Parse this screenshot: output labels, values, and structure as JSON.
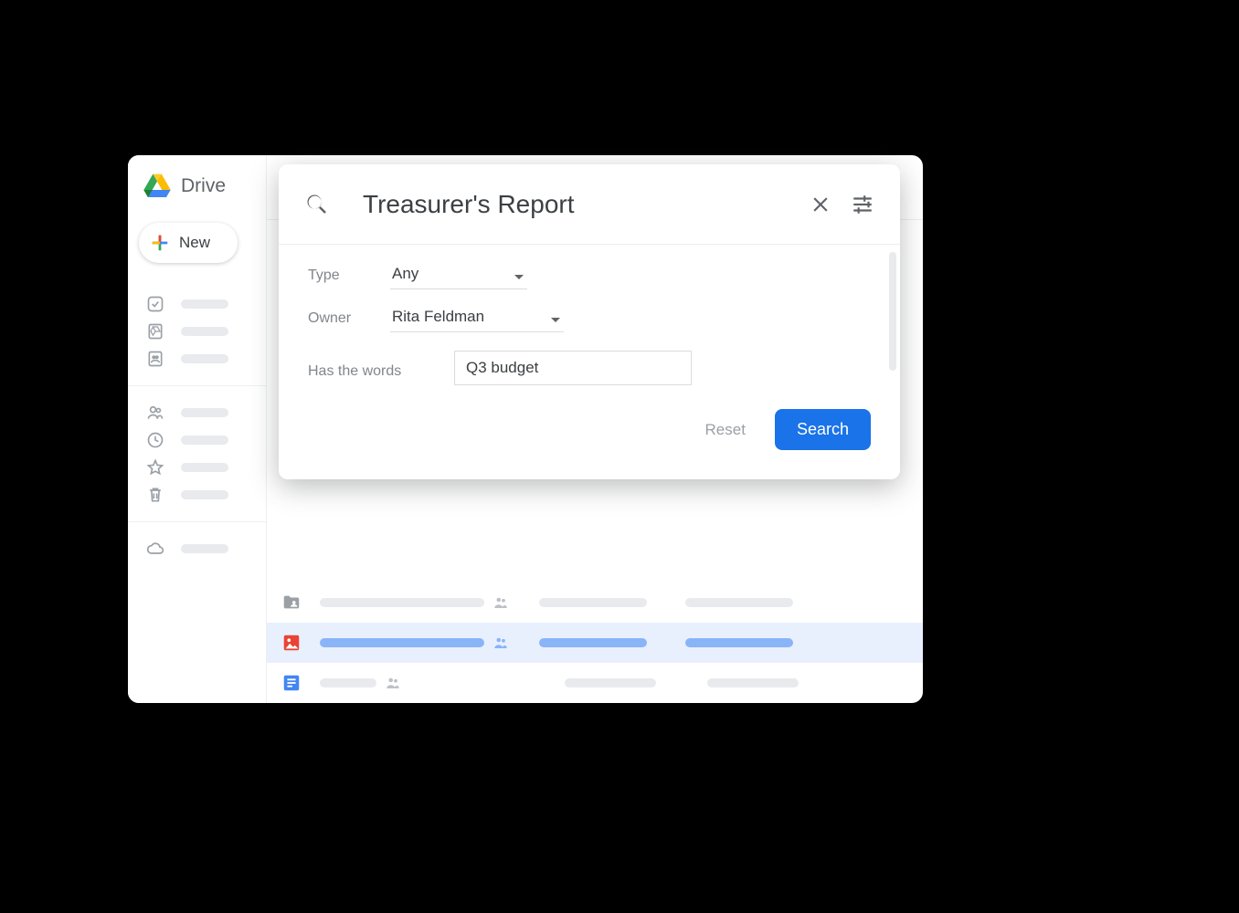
{
  "brand": {
    "title": "Drive"
  },
  "new_button": {
    "label": "New"
  },
  "search": {
    "query": "Treasurer's Report",
    "filters": {
      "type_label": "Type",
      "type_value": "Any",
      "owner_label": "Owner",
      "owner_value": "Rita Feldman",
      "words_label": "Has the words",
      "words_value": "Q3 budget"
    },
    "actions": {
      "reset": "Reset",
      "search": "Search"
    }
  }
}
